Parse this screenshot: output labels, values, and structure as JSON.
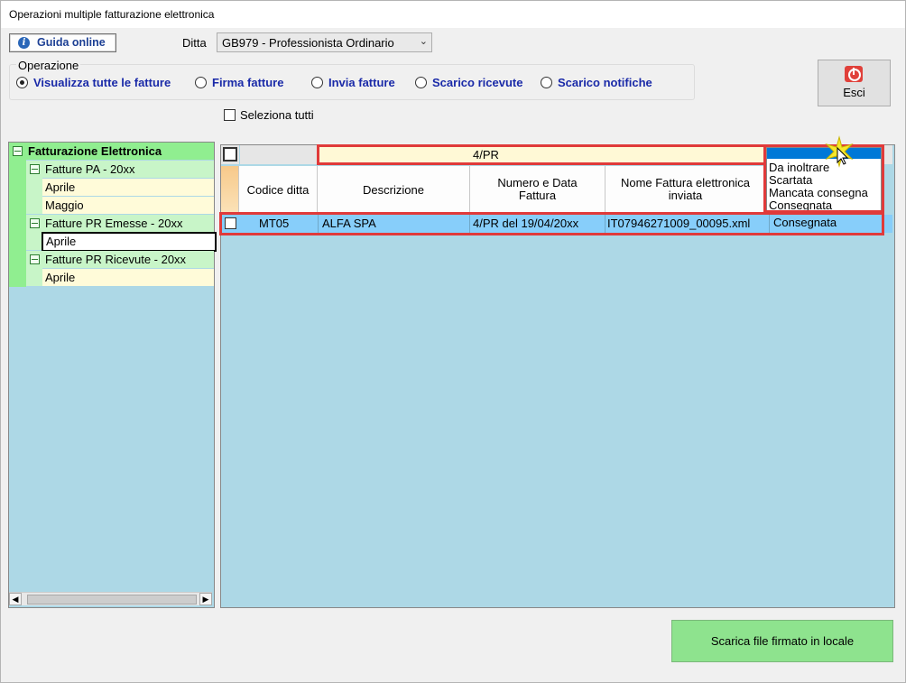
{
  "window": {
    "title": "Operazioni multiple fatturazione elettronica"
  },
  "toolbar": {
    "guida_label": "Guida online",
    "ditta_label": "Ditta",
    "ditta_value": "GB979 - Professionista Ordinario",
    "esci_label": "Esci"
  },
  "operazione": {
    "title": "Operazione",
    "options": [
      "Visualizza tutte le fatture",
      "Firma fatture",
      "Invia fatture",
      "Scarico ricevute",
      "Scarico notifiche"
    ],
    "selected": "Visualizza tutte le fatture"
  },
  "seleziona_tutti": "Seleziona tutti",
  "tree": {
    "root": "Fatturazione Elettronica",
    "groups": [
      {
        "label": "Fatture PA - 20xx",
        "items": [
          "Aprile",
          "Maggio"
        ]
      },
      {
        "label": "Fatture PR Emesse - 20xx",
        "items": [
          "Aprile"
        ]
      },
      {
        "label": "Fatture PR Ricevute - 20xx",
        "items": [
          "Aprile"
        ]
      }
    ],
    "selected": "Aprile"
  },
  "grid": {
    "filter_value": "4/PR",
    "headers": [
      "Codice ditta",
      "Descrizione",
      "Numero e Data Fattura",
      "Nome Fattura elettronica inviata"
    ],
    "rows": [
      {
        "codice": "MT05",
        "descrizione": "ALFA SPA",
        "numero": "4/PR del 19/04/20xx",
        "nome_file": "IT07946271009_00095.xml",
        "stato": "Consegnata"
      }
    ],
    "status_options": [
      "Da inoltrare",
      "Scartata",
      "Mancata consegna",
      "Consegnata"
    ]
  },
  "scarica_button": "Scarica file firmato in locale",
  "colors": {
    "grid_bg": "#add8e6",
    "highlight_red": "#e03a3a",
    "tree_header": "#90ee90",
    "scarica_bg": "#8ee38e"
  }
}
